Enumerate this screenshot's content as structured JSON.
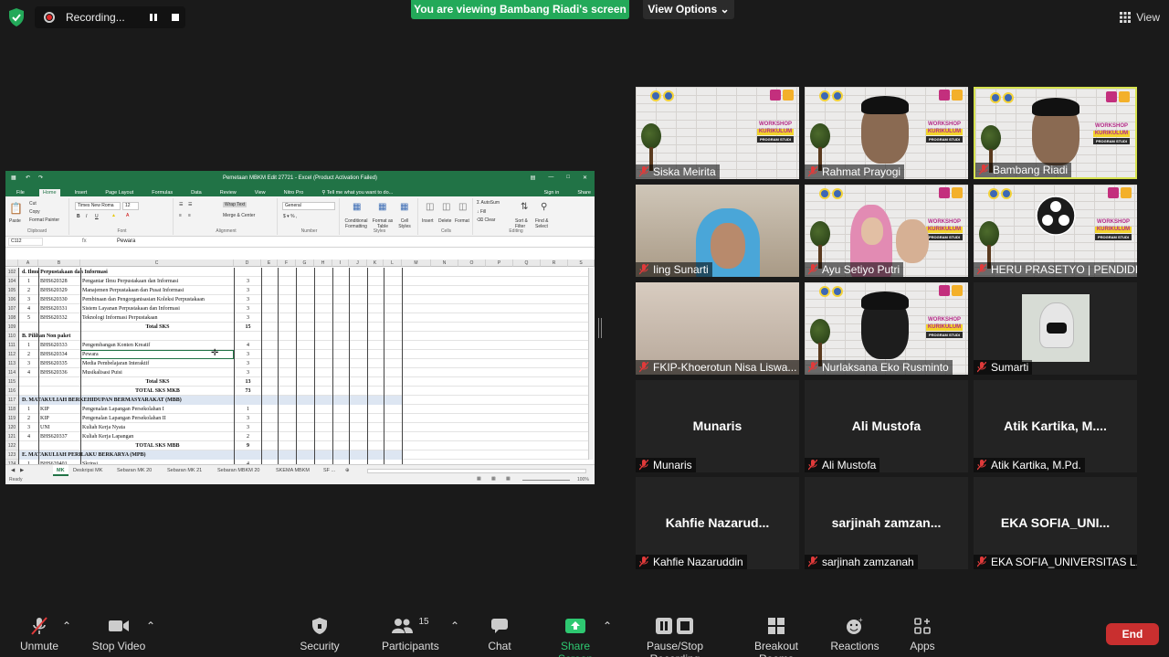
{
  "top": {
    "recording_label": "Recording...",
    "banner": "You are viewing Bambang Riadi's screen",
    "view_options": "View Options",
    "view_button": "View"
  },
  "excel": {
    "title": "Pemetaan MBKM Edit 27721 - Excel (Product Activation Failed)",
    "menu": [
      "File",
      "Home",
      "Insert",
      "Page Layout",
      "Formulas",
      "Data",
      "Review",
      "View",
      "Nitro Pro"
    ],
    "tell_me": "Tell me what you want to do...",
    "sign_in": "Sign in",
    "share": "Share",
    "ribbon": {
      "cut": "Cut",
      "copy": "Copy",
      "paste": "Paste",
      "format_painter": "Format Painter",
      "font_name": "Times New Roma",
      "font_size": "12",
      "wrap_text": "Wrap Text",
      "merge_center": "Merge & Center",
      "number_format": "General",
      "conditional_formatting": "Conditional Formatting",
      "format_as_table": "Format as Table",
      "cell_styles": "Cell Styles",
      "insert": "Insert",
      "delete": "Delete",
      "format": "Format",
      "autosum": "AutoSum",
      "fill": "Fill",
      "clear": "Clear",
      "sort_filter": "Sort & Filter",
      "find_select": "Find & Select",
      "groups": [
        "Clipboard",
        "Font",
        "Alignment",
        "Number",
        "Styles",
        "Cells",
        "Editing"
      ]
    },
    "name_box": "C112",
    "formula_value": "Pewara",
    "columns": [
      "A",
      "B",
      "C",
      "D",
      "E",
      "F",
      "G",
      "H",
      "I",
      "J",
      "K",
      "L",
      "M",
      "N",
      "O",
      "P",
      "Q",
      "R",
      "S"
    ],
    "rows": [
      {
        "n": "102",
        "a": "",
        "b": "d. Ilmu Perpustakaan dan Informasi",
        "c": "",
        "d": "",
        "type": "section"
      },
      {
        "n": "104",
        "a": "1",
        "b": "BHS620328",
        "c": "Pengantar Ilmu Perpustakaan dan Informasi",
        "d": "3",
        "type": "row"
      },
      {
        "n": "105",
        "a": "2",
        "b": "BHS620329",
        "c": "Manajemen Perpustakaan dan Pusat Informasi",
        "d": "3",
        "type": "row"
      },
      {
        "n": "106",
        "a": "3",
        "b": "BHS620330",
        "c": "Pembinaan dan Pengorganisasian Koleksi Perpustakaan",
        "d": "3",
        "type": "row"
      },
      {
        "n": "107",
        "a": "4",
        "b": "BHS620331",
        "c": "Sistem Layanan Perpustakaan dan Informasi",
        "d": "3",
        "type": "row"
      },
      {
        "n": "108",
        "a": "5",
        "b": "BHS620332",
        "c": "Teknologi Informasi Perpustakaan",
        "d": "3",
        "type": "row"
      },
      {
        "n": "109",
        "a": "",
        "b": "",
        "c": "Total SKS",
        "d": "15",
        "type": "total"
      },
      {
        "n": "110",
        "a": "",
        "b": "B. Pilihan Non paket",
        "c": "",
        "d": "",
        "type": "section"
      },
      {
        "n": "111",
        "a": "1",
        "b": "BHS620333",
        "c": "Pengembangan Konten Kreatif",
        "d": "4",
        "type": "row"
      },
      {
        "n": "112",
        "a": "2",
        "b": "BHS620334",
        "c": "Pewara",
        "d": "3",
        "type": "row"
      },
      {
        "n": "113",
        "a": "3",
        "b": "BHS620335",
        "c": "Media Pembelajaran Interaktif",
        "d": "3",
        "type": "row"
      },
      {
        "n": "114",
        "a": "4",
        "b": "BHS620336",
        "c": "Musikalisasi Puisi",
        "d": "3",
        "type": "row"
      },
      {
        "n": "115",
        "a": "",
        "b": "",
        "c": "Total SKS",
        "d": "13",
        "type": "total"
      },
      {
        "n": "116",
        "a": "",
        "b": "",
        "c": "TOTAL SKS MKB",
        "d": "73",
        "type": "total"
      },
      {
        "n": "117",
        "a": "",
        "b": "D. MATAKULIAH BERKEHIDUPAN BERMASYARAKAT (MBB)",
        "c": "",
        "d": "",
        "type": "header"
      },
      {
        "n": "118",
        "a": "1",
        "b": "KIP",
        "c": "Pengenalan Lapangan Persekolahan I",
        "d": "1",
        "type": "row"
      },
      {
        "n": "119",
        "a": "2",
        "b": "KIP",
        "c": "Pengenalan Lapangan Persekolahan II",
        "d": "3",
        "type": "row"
      },
      {
        "n": "120",
        "a": "3",
        "b": "UNI",
        "c": "Kuliah Kerja Nyata",
        "d": "3",
        "type": "row"
      },
      {
        "n": "121",
        "a": "4",
        "b": "BHS620337",
        "c": "Kuliah Kerja Lapangan",
        "d": "2",
        "type": "row"
      },
      {
        "n": "122",
        "a": "",
        "b": "",
        "c": "TOTAL SKS MBB",
        "d": "9",
        "type": "total"
      },
      {
        "n": "123",
        "a": "",
        "b": "E. MATAKULIAH PERILAKU BERKARYA (MPB)",
        "c": "",
        "d": "",
        "type": "header"
      },
      {
        "n": "124",
        "a": "1",
        "b": "BHS620401",
        "c": "Skripsi",
        "d": "4",
        "type": "row"
      }
    ],
    "sheet_tabs": [
      "MK",
      "Deskripsi MK",
      "Sebaran MK 20",
      "Sebaran MK 21",
      "Sebaran MBKM 20",
      "SKEMA MBKM",
      "SF ..."
    ],
    "status": "Ready",
    "zoom": "100%"
  },
  "participants": [
    {
      "name": "Siska Meirita",
      "video": true,
      "active": false
    },
    {
      "name": "Rahmat Prayogi",
      "video": true,
      "active": false
    },
    {
      "name": "Bambang Riadi",
      "video": true,
      "active": true
    },
    {
      "name": "Iing Sunarti",
      "video": true,
      "active": false
    },
    {
      "name": "Ayu Setiyo Putri",
      "video": true,
      "active": false
    },
    {
      "name": "HERU PRASETYO | PENDIDI...",
      "video": true,
      "active": false
    },
    {
      "name": "FKIP-Khoerotun Nisa Liswa...",
      "video": true,
      "active": false
    },
    {
      "name": "Nurlaksana Eko Rusminto",
      "video": true,
      "active": false
    },
    {
      "name": "Sumarti",
      "video": true,
      "active": false
    },
    {
      "name": "Munaris",
      "center": "Munaris",
      "video": false
    },
    {
      "name": "Ali Mustofa",
      "center": "Ali Mustofa",
      "video": false
    },
    {
      "name": "Atik Kartika, M.Pd.",
      "center": "Atik Kartika, M....",
      "video": false
    },
    {
      "name": "Kahfie Nazaruddin",
      "center": "Kahfie Nazarud...",
      "video": false
    },
    {
      "name": "sarjinah zamzanah",
      "center": "sarjinah zamzan...",
      "video": false
    },
    {
      "name": "EKA SOFIA_UNIVERSITAS L...",
      "center": "EKA SOFIA_UNI...",
      "video": false
    }
  ],
  "poster": {
    "line1": "WORKSHOP",
    "line2": "KURIKULUM",
    "line3": "PROGRAM STUDI"
  },
  "toolbar": {
    "unmute": "Unmute",
    "stop_video": "Stop Video",
    "security": "Security",
    "participants": "Participants",
    "participants_count": "15",
    "chat": "Chat",
    "share_screen": "Share Screen",
    "pause_recording": "Pause/Stop Recording",
    "breakout_rooms": "Breakout Rooms",
    "reactions": "Reactions",
    "apps": "Apps",
    "end": "End"
  },
  "colors": {
    "share_green": "#23a959",
    "end_red": "#c92f2f",
    "excel_green": "#217346",
    "active_border": "#d7e34f"
  }
}
